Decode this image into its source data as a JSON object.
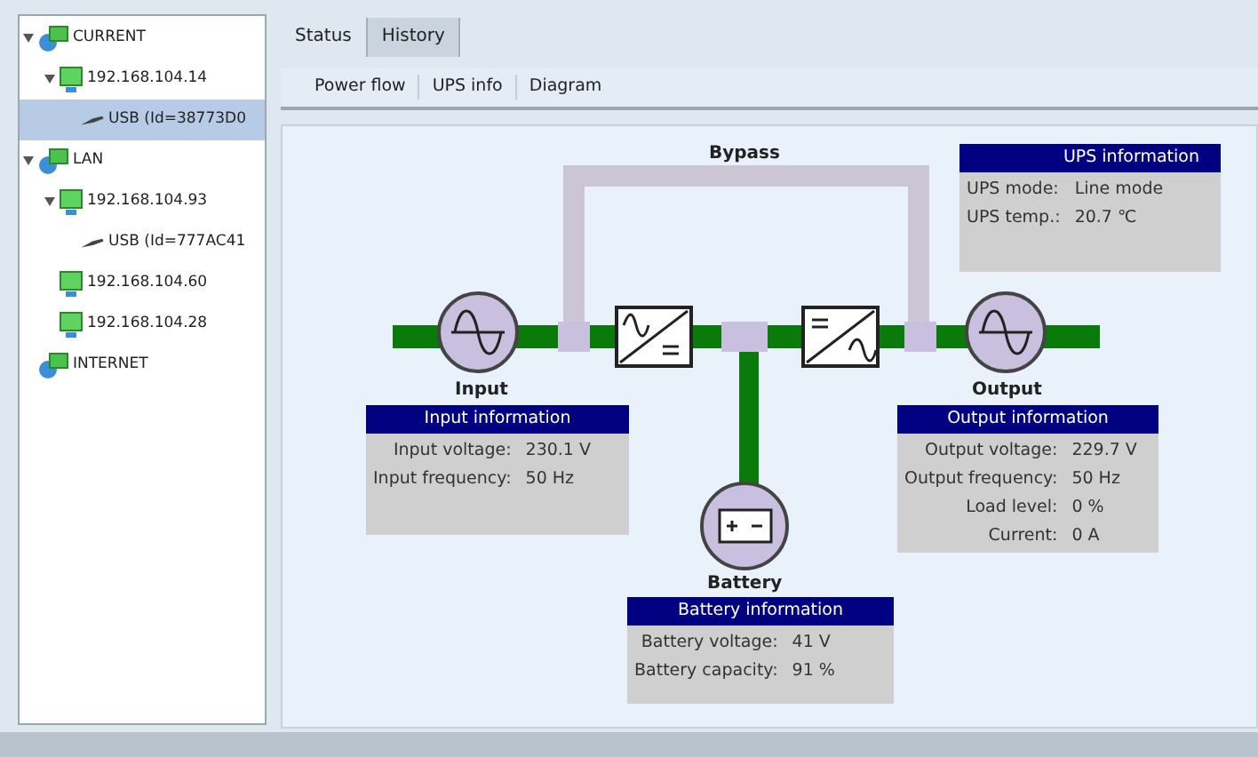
{
  "tree": [
    {
      "label": "CURRENT",
      "kind": "network",
      "expanded": true,
      "selected": false,
      "children": [
        {
          "label": "192.168.104.14",
          "kind": "computer",
          "expanded": true,
          "selected": false,
          "children": [
            {
              "label": "USB (Id=38773D0",
              "kind": "usb",
              "selected": true
            }
          ]
        }
      ]
    },
    {
      "label": "LAN",
      "kind": "network",
      "expanded": true,
      "selected": false,
      "children": [
        {
          "label": "192.168.104.93",
          "kind": "computer",
          "expanded": true,
          "selected": false,
          "children": [
            {
              "label": "USB (Id=777AC41",
              "kind": "usb",
              "selected": false
            }
          ]
        },
        {
          "label": "192.168.104.60",
          "kind": "computer",
          "selected": false
        },
        {
          "label": "192.168.104.28",
          "kind": "computer",
          "selected": false
        }
      ]
    },
    {
      "label": "INTERNET",
      "kind": "network",
      "selected": false
    }
  ],
  "tabs": [
    {
      "label": "Status",
      "selected": true
    },
    {
      "label": "History",
      "selected": false
    }
  ],
  "toolbar": [
    "Power flow",
    "UPS info",
    "Diagram"
  ],
  "diagram": {
    "bypass_label": "Bypass",
    "input_label": "Input",
    "output_label": "Output",
    "battery_label": "Battery",
    "panels": [
      {
        "kind": "ups",
        "title": "UPS information",
        "rows": [
          {
            "label": "UPS mode:",
            "value": "Line mode"
          },
          {
            "label": "UPS temp.:",
            "value": "20.7  ℃"
          }
        ]
      },
      {
        "kind": "input",
        "title": "Input information",
        "rows": [
          {
            "label": "Input voltage:",
            "value": "230.1 V"
          },
          {
            "label": "Input frequency:",
            "value": "50 Hz"
          }
        ]
      },
      {
        "kind": "output",
        "title": "Output information",
        "rows": [
          {
            "label": "Output voltage:",
            "value": "229.7 V"
          },
          {
            "label": "Output frequency:",
            "value": "50 Hz"
          },
          {
            "label": "Load level:",
            "value": "0 %"
          },
          {
            "label": "Current:",
            "value": "0 A"
          }
        ]
      },
      {
        "kind": "battery",
        "title": "Battery information",
        "rows": [
          {
            "label": "Battery voltage:",
            "value": "41 V"
          },
          {
            "label": "Battery capacity:",
            "value": "91 %"
          }
        ]
      }
    ]
  }
}
